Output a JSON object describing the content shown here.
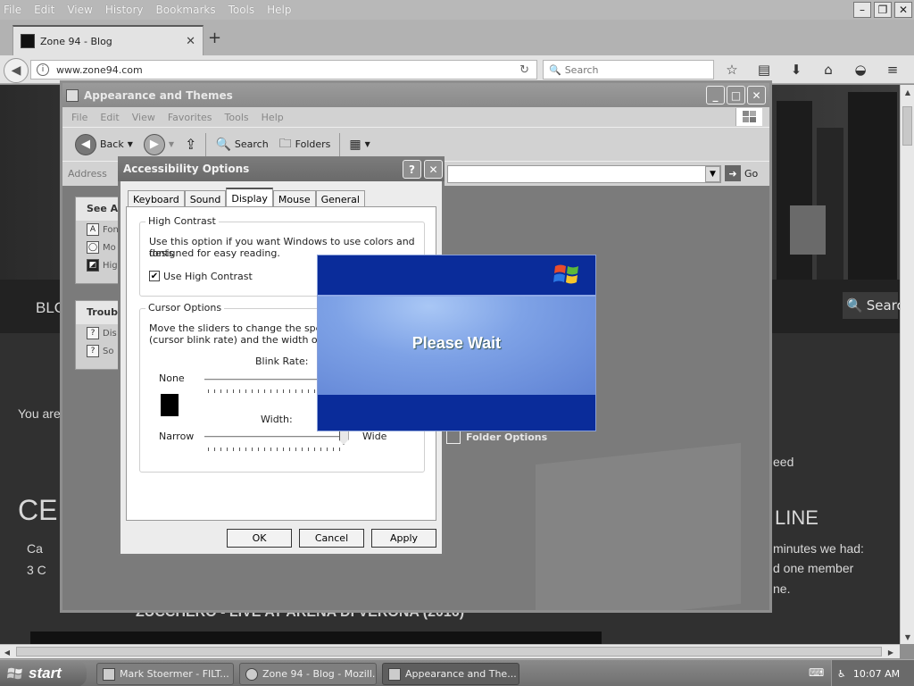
{
  "browser": {
    "menu": [
      "File",
      "Edit",
      "View",
      "History",
      "Bookmarks",
      "Tools",
      "Help"
    ],
    "tab_title": "Zone 94 - Blog",
    "url": "www.zone94.com",
    "search_placeholder": "Search"
  },
  "webpage": {
    "nav_left": "BLO",
    "search_label": "Search",
    "you_are": "You are",
    "speed_fragment": "eed",
    "cel_fragment": "CEL",
    "line_fragment": "LINE",
    "ca_fragment": "Ca",
    "comment_count": "3 C",
    "minutes_text": "minutes we had:",
    "member_text": "d one member",
    "ne_text": "ne.",
    "bottom_heading": "ZUCCHERO - LIVE AT ARENA DI VERONA (2016)"
  },
  "explorer": {
    "title": "Appearance and Themes",
    "menu": [
      "File",
      "Edit",
      "View",
      "Favorites",
      "Tools",
      "Help"
    ],
    "toolbar": {
      "back": "Back",
      "search": "Search",
      "folders": "Folders"
    },
    "address_label": "Address",
    "go_label": "Go",
    "see_also": {
      "title": "See Als",
      "items": [
        "Fon",
        "Mo",
        "Hig"
      ]
    },
    "troubleshooters": {
      "title": "Troubl",
      "items": [
        "Dis",
        "So"
      ]
    },
    "folder_options": "Folder Options"
  },
  "accessibility": {
    "title": "Accessibility Options",
    "tabs": [
      "Keyboard",
      "Sound",
      "Display",
      "Mouse",
      "General"
    ],
    "active_tab": "Display",
    "high_contrast": {
      "group_label": "High Contrast",
      "description_line1": "Use this option if you want Windows to use colors and fonts",
      "description_line2": "designed for easy reading.",
      "checkbox_label": "Use High Contrast",
      "checked": true
    },
    "cursor_options": {
      "group_label": "Cursor Options",
      "description_line1": "Move the sliders to change the speed th",
      "description_line2": "(cursor blink rate) and the width of the cu",
      "blink_rate_label": "Blink Rate:",
      "none_label": "None",
      "width_label": "Width:",
      "narrow_label": "Narrow",
      "wide_label": "Wide",
      "width_value": 1.0
    },
    "buttons": {
      "ok": "OK",
      "cancel": "Cancel",
      "apply": "Apply"
    }
  },
  "splash": {
    "message": "Please Wait"
  },
  "taskbar": {
    "start": "start",
    "tasks": [
      "Mark Stoermer - FILT...",
      "Zone 94 - Blog - Mozill...",
      "Appearance and The..."
    ],
    "active_task": 2,
    "clock": "10:07 AM"
  }
}
